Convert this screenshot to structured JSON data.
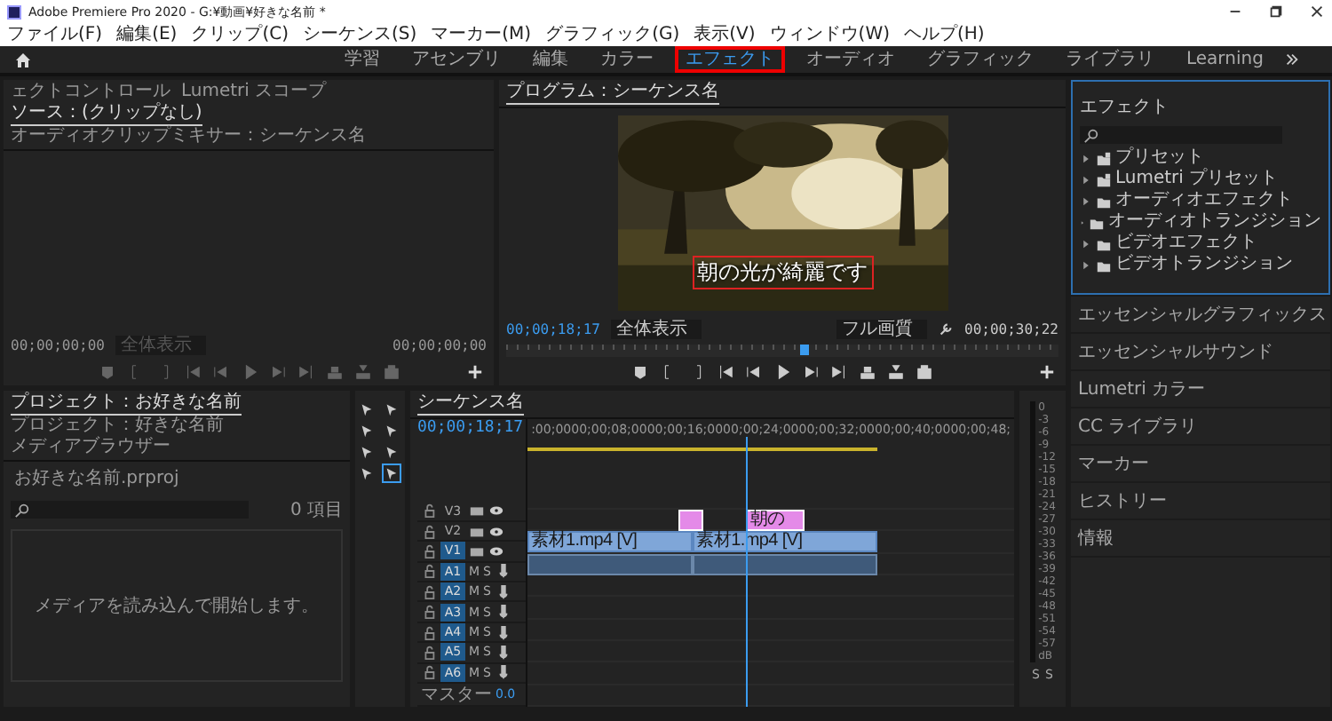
{
  "window": {
    "title": "Adobe Premiere Pro 2020 - G:¥動画¥好きな名前 *"
  },
  "menu": [
    "ファイル(F)",
    "編集(E)",
    "クリップ(C)",
    "シーケンス(S)",
    "マーカー(M)",
    "グラフィック(G)",
    "表示(V)",
    "ウィンドウ(W)",
    "ヘルプ(H)"
  ],
  "workspaces": [
    {
      "label": "学習",
      "selected": false,
      "highlighted": false
    },
    {
      "label": "アセンブリ",
      "selected": false,
      "highlighted": false
    },
    {
      "label": "編集",
      "selected": false,
      "highlighted": false
    },
    {
      "label": "カラー",
      "selected": false,
      "highlighted": false
    },
    {
      "label": "エフェクト",
      "selected": true,
      "highlighted": true
    },
    {
      "label": "オーディオ",
      "selected": false,
      "highlighted": false
    },
    {
      "label": "グラフィック",
      "selected": false,
      "highlighted": false
    },
    {
      "label": "ライブラリ",
      "selected": false,
      "highlighted": false
    },
    {
      "label": "Learning",
      "selected": false,
      "highlighted": false
    }
  ],
  "source_monitor": {
    "tabs": [
      {
        "label": "ェクトコントロール",
        "selected": false
      },
      {
        "label": "Lumetri スコープ",
        "selected": false
      },
      {
        "label": "ソース：(クリップなし)",
        "selected": true
      },
      {
        "label": "オーディオクリップミキサー：シーケンス名",
        "selected": false
      }
    ],
    "timecode": "00;00;00;00",
    "zoom": {
      "value": "全体表示",
      "disabled": true
    },
    "duration": "00;00;00;00"
  },
  "program_monitor": {
    "tab": "プログラム：シーケンス名",
    "timecode": "00;00;18;17",
    "zoom": "全体表示",
    "quality": "フル画質",
    "duration": "00;00;30;22",
    "caption": "朝の光が綺麗です",
    "scrubber": {
      "level": 0.54
    }
  },
  "effects": {
    "title": "エフェクト",
    "items": [
      {
        "label": "プリセット",
        "kind": "preset",
        "expanded": false
      },
      {
        "label": "Lumetri プリセット",
        "kind": "preset",
        "expanded": false
      },
      {
        "label": "オーディオエフェクト",
        "kind": "folder",
        "expanded": false
      },
      {
        "label": "オーディオトランジション",
        "kind": "folder",
        "expanded": false
      },
      {
        "label": "ビデオエフェクト",
        "kind": "folder",
        "expanded": false
      },
      {
        "label": "ビデオトランジション",
        "kind": "folder",
        "expanded": false
      }
    ]
  },
  "panels": [
    "エッセンシャルグラフィックス",
    "エッセンシャルサウンド",
    "Lumetri カラー",
    "CC ライブラリ",
    "マーカー",
    "ヒストリー",
    "情報"
  ],
  "project": {
    "tabs": [
      {
        "label": "プロジェクト：お好きな名前",
        "selected": true
      },
      {
        "label": "プロジェクト：好きな名前",
        "selected": false
      },
      {
        "label": "メディアブラウザー",
        "selected": false
      }
    ],
    "file": "お好きな名前.prproj",
    "count": "0 項目",
    "empty_message": "メディアを読み込んで開始します。"
  },
  "timeline": {
    "tab": "シーケンス名",
    "timecode": "00;00;18;17",
    "ruler": [
      ":00;00",
      "00;00;08;00",
      "00;00;16;00",
      "00;00;24;00",
      "00;00;32;00",
      "00;00;40;00",
      "00;00;48;"
    ],
    "playhead": {
      "level": 0.45
    },
    "video_tracks": [
      {
        "name": "V3",
        "targeted": false
      },
      {
        "name": "V2",
        "targeted": false,
        "clips": [
          {
            "kind": "graphic"
          },
          {
            "kind": "graphic",
            "label": "朝の"
          }
        ]
      },
      {
        "name": "V1",
        "targeted": true,
        "clips": [
          {
            "kind": "video",
            "label": "素材1.mp4 [V]"
          },
          {
            "kind": "video",
            "label": "素材1.mp4 [V]"
          }
        ]
      }
    ],
    "audio_tracks": [
      {
        "name": "A1",
        "targeted": true,
        "mute": "M",
        "solo": "S",
        "clips": [
          {
            "kind": "audio"
          },
          {
            "kind": "audio"
          }
        ]
      },
      {
        "name": "A2",
        "targeted": true,
        "mute": "M",
        "solo": "S"
      },
      {
        "name": "A3",
        "targeted": true,
        "mute": "M",
        "solo": "S"
      },
      {
        "name": "A4",
        "targeted": true,
        "mute": "M",
        "solo": "S"
      },
      {
        "name": "A5",
        "targeted": true,
        "mute": "M",
        "solo": "S"
      },
      {
        "name": "A6",
        "targeted": true,
        "mute": "M",
        "solo": "S"
      }
    ],
    "master": {
      "label": "マスター",
      "value": "0.0"
    }
  },
  "meter": {
    "scale": [
      "0",
      "-3",
      "-6",
      "-9",
      "-12",
      "-15",
      "-18",
      "-21",
      "-24",
      "-27",
      "-30",
      "-33",
      "-36",
      "-39",
      "-42",
      "-45",
      "-48",
      "-51",
      "-54",
      "-57",
      "dB"
    ],
    "channels": [
      "S",
      "S"
    ]
  }
}
